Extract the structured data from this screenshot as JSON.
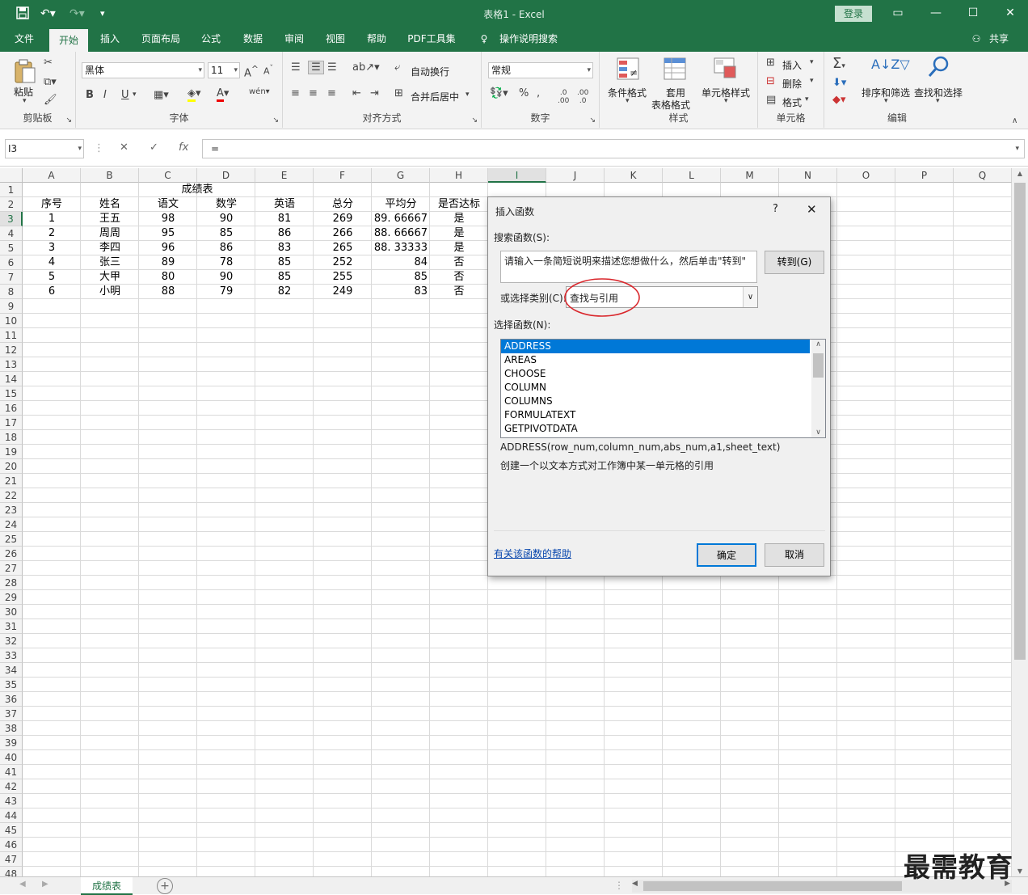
{
  "app": {
    "title": "表格1 - Excel",
    "login": "登录",
    "share": "共享"
  },
  "tabs": [
    "文件",
    "开始",
    "插入",
    "页面布局",
    "公式",
    "数据",
    "审阅",
    "视图",
    "帮助",
    "PDF工具集",
    "操作说明搜索"
  ],
  "ribbon": {
    "clipboard": {
      "label": "剪贴板",
      "paste": "粘贴"
    },
    "font": {
      "label": "字体",
      "name": "黑体",
      "size": "11",
      "bold": "B",
      "italic": "I",
      "underline": "U"
    },
    "align": {
      "label": "对齐方式",
      "wrap": "自动换行",
      "merge": "合并后居中"
    },
    "number": {
      "label": "数字",
      "format": "常规"
    },
    "styles": {
      "label": "样式",
      "conditional": "条件格式",
      "table_fmt_1": "套用",
      "table_fmt_2": "表格格式",
      "cell_styles": "单元格样式"
    },
    "cells": {
      "label": "单元格",
      "insert": "插入",
      "delete": "删除",
      "format": "格式"
    },
    "editing": {
      "label": "编辑",
      "sort": "排序和筛选",
      "find": "查找和选择"
    }
  },
  "formula_bar": {
    "name_box": "I3",
    "formula": "="
  },
  "columns": [
    "A",
    "B",
    "C",
    "D",
    "E",
    "F",
    "G",
    "H",
    "I",
    "J",
    "K",
    "L",
    "M",
    "N",
    "O",
    "P",
    "Q"
  ],
  "selected_column": "I",
  "selected_row": 3,
  "rows": [
    "1",
    "2",
    "3",
    "4",
    "5",
    "6",
    "7",
    "8",
    "9",
    "10",
    "11",
    "12",
    "13",
    "14",
    "15",
    "16",
    "17",
    "18",
    "19",
    "20",
    "21",
    "22",
    "23",
    "24",
    "25",
    "26",
    "27",
    "28",
    "29",
    "30",
    "31",
    "32",
    "33",
    "34",
    "35",
    "36",
    "37",
    "38",
    "39",
    "40",
    "41",
    "42",
    "43",
    "44",
    "45",
    "46",
    "47",
    "48"
  ],
  "sheet": {
    "title": "成绩表",
    "headers": [
      "序号",
      "姓名",
      "语文",
      "数学",
      "英语",
      "总分",
      "平均分",
      "是否达标"
    ],
    "data": [
      [
        "1",
        "王五",
        "98",
        "90",
        "81",
        "269",
        "89. 66667",
        "是"
      ],
      [
        "2",
        "周周",
        "95",
        "85",
        "86",
        "266",
        "88. 66667",
        "是"
      ],
      [
        "3",
        "李四",
        "96",
        "86",
        "83",
        "265",
        "88. 33333",
        "是"
      ],
      [
        "4",
        "张三",
        "89",
        "78",
        "85",
        "252",
        "84",
        "否"
      ],
      [
        "5",
        "大甲",
        "80",
        "90",
        "85",
        "255",
        "85",
        "否"
      ],
      [
        "6",
        "小明",
        "88",
        "79",
        "82",
        "249",
        "83",
        "否"
      ]
    ]
  },
  "sheet_tab": "成绩表",
  "dialog": {
    "title": "插入函数",
    "help_char": "?",
    "search_label": "搜索函数(S):",
    "search_placeholder": "请输入一条简短说明来描述您想做什么，然后单击\"转到\"",
    "go_button": "转到(G)",
    "category_label": "或选择类别(C):",
    "category_value": "查找与引用",
    "function_label": "选择函数(N):",
    "functions": [
      "ADDRESS",
      "AREAS",
      "CHOOSE",
      "COLUMN",
      "COLUMNS",
      "FORMULATEXT",
      "GETPIVOTDATA"
    ],
    "selected_function": "ADDRESS",
    "signature": "ADDRESS(row_num,column_num,abs_num,a1,sheet_text)",
    "description": "创建一个以文本方式对工作簿中某一单元格的引用",
    "help_link": "有关该函数的帮助",
    "ok": "确定",
    "cancel": "取消"
  },
  "watermark": "最需教育",
  "colors": {
    "excel_green": "#217346",
    "selection_blue": "#0078d7",
    "annotation_red": "#d9262b"
  }
}
